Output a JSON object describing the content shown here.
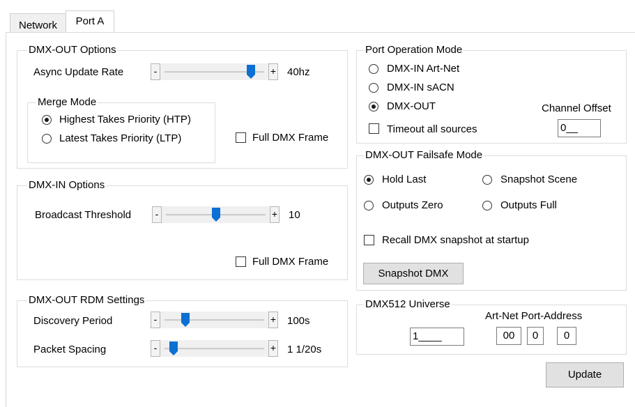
{
  "tabs": [
    {
      "label": "Network"
    },
    {
      "label": "Port A"
    }
  ],
  "dmx_out_options": {
    "title": "DMX-OUT Options",
    "async_label": "Async Update Rate",
    "async_minus": "-",
    "async_plus": "+",
    "async_value": "40hz",
    "async_level": 0.9,
    "merge_title": "Merge Mode",
    "htp_label": "Highest Takes Priority (HTP)",
    "ltp_label": "Latest Takes Priority (LTP)",
    "htp_selected": true,
    "full_frame_label": "Full DMX Frame",
    "full_frame_checked": false
  },
  "dmx_in_options": {
    "title": "DMX-IN Options",
    "broadcast_label": "Broadcast Threshold",
    "broadcast_minus": "-",
    "broadcast_plus": "+",
    "broadcast_value": "10",
    "broadcast_level": 0.5,
    "full_frame_label": "Full DMX Frame",
    "full_frame_checked": false
  },
  "rdm_settings": {
    "title": "DMX-OUT RDM Settings",
    "discovery_label": "Discovery Period",
    "discovery_minus": "-",
    "discovery_plus": "+",
    "discovery_value": "100s",
    "discovery_level": 0.18,
    "packet_label": "Packet Spacing",
    "packet_minus": "-",
    "packet_plus": "+",
    "packet_value": "1 1/20s",
    "packet_level": 0.05
  },
  "port_operation": {
    "title": "Port Operation Mode",
    "options": [
      "DMX-IN Art-Net",
      "DMX-IN sACN",
      "DMX-OUT"
    ],
    "selected": "DMX-OUT",
    "timeout_label": "Timeout all sources",
    "timeout_checked": false,
    "channel_offset_label": "Channel Offset",
    "channel_offset_value": "0__"
  },
  "failsafe": {
    "title": "DMX-OUT Failsafe Mode",
    "hold_last": "Hold Last",
    "snapshot_scene": "Snapshot Scene",
    "outputs_zero": "Outputs Zero",
    "outputs_full": "Outputs Full",
    "selected": "Hold Last",
    "recall_label": "Recall DMX snapshot at startup",
    "recall_checked": false,
    "snapshot_button": "Snapshot DMX"
  },
  "universe": {
    "title": "DMX512 Universe",
    "value": "1____",
    "artnet_label": "Art-Net Port-Address",
    "addr": [
      "00",
      "0",
      "0"
    ]
  },
  "update_button": "Update"
}
